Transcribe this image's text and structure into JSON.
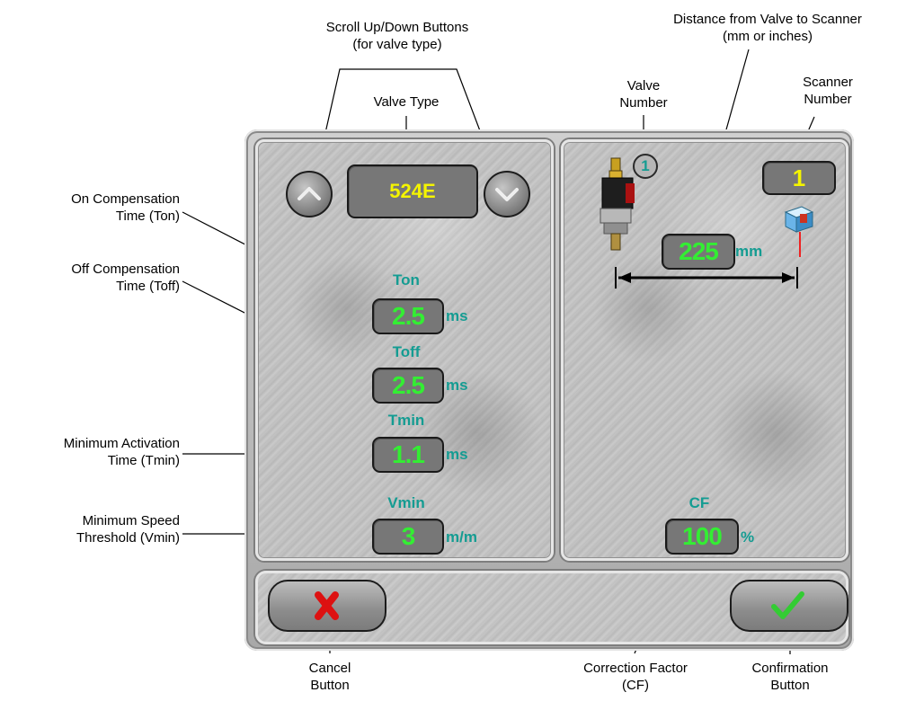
{
  "callouts": {
    "scroll_buttons": "Scroll Up/Down Buttons\n(for valve type)",
    "valve_type": "Valve Type",
    "on_comp": "On Compensation\nTime (Ton)",
    "off_comp": "Off Compensation\nTime (Toff)",
    "min_activation": "Minimum Activation\nTime (Tmin)",
    "min_speed": "Minimum Speed\nThreshold (Vmin)",
    "distance": "Distance from Valve to Scanner\n(mm or inches)",
    "valve_number": "Valve\nNumber",
    "scanner_number": "Scanner\nNumber",
    "cancel": "Cancel\nButton",
    "correction": "Correction Factor\n(CF)",
    "confirmation": "Confirmation\nButton"
  },
  "left_panel": {
    "valve_type_value": "524E",
    "ton": {
      "label": "Ton",
      "value": "2.5",
      "unit": "ms"
    },
    "toff": {
      "label": "Toff",
      "value": "2.5",
      "unit": "ms"
    },
    "tmin": {
      "label": "Tmin",
      "value": "1.1",
      "unit": "ms"
    },
    "vmin": {
      "label": "Vmin",
      "value": "3",
      "unit": "m/m"
    }
  },
  "right_panel": {
    "valve_number": "1",
    "scanner_number": "1",
    "distance": {
      "value": "225",
      "unit": "mm"
    },
    "cf": {
      "label": "CF",
      "value": "100",
      "unit": "%"
    }
  },
  "icons": {
    "scroll_up": "chevron-up-icon",
    "scroll_down": "chevron-down-icon",
    "cancel": "red-x-icon",
    "confirm": "green-check-icon",
    "valve": "valve-icon",
    "scanner": "scanner-icon"
  },
  "colors": {
    "lcd_green": "#33ee33",
    "lcd_yellow": "#f4f400",
    "label_teal": "#149c92",
    "cancel_red": "#dd1111",
    "confirm_green": "#33cc33"
  }
}
